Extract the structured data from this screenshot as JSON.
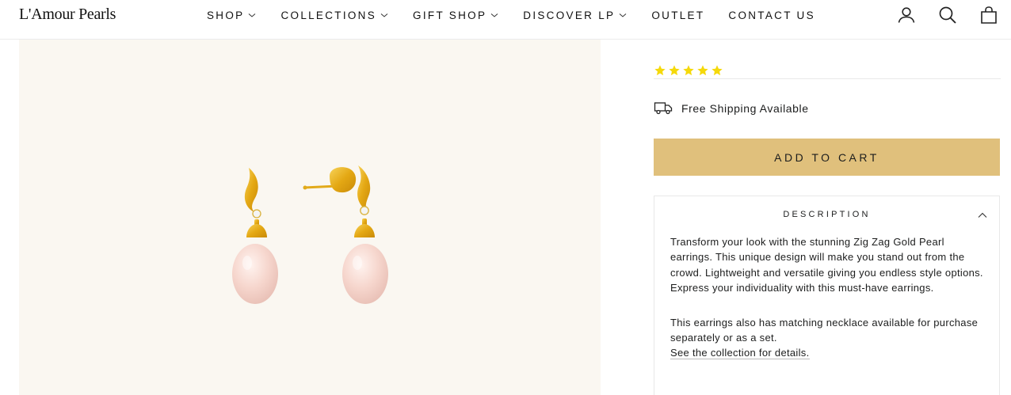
{
  "brand": {
    "logo_text": "L'Amour Pearls"
  },
  "nav": {
    "items": [
      {
        "label": "SHOP",
        "has_dropdown": true
      },
      {
        "label": "COLLECTIONS",
        "has_dropdown": true
      },
      {
        "label": "GIFT SHOP",
        "has_dropdown": true
      },
      {
        "label": "DISCOVER LP",
        "has_dropdown": true
      },
      {
        "label": "OUTLET",
        "has_dropdown": false
      },
      {
        "label": "CONTACT US",
        "has_dropdown": false
      }
    ]
  },
  "header_icons": [
    "user-icon",
    "search-icon",
    "cart-icon"
  ],
  "product": {
    "rating": {
      "stars": 5,
      "star_color": "#f5d90a"
    },
    "shipping_text": "Free Shipping Available",
    "add_to_cart_label": "ADD TO CART",
    "button_color": "#e0c07c",
    "description": {
      "title": "DESCRIPTION",
      "paragraph_1": "Transform your look with the stunning Zig Zag Gold Pearl earrings. This unique design will make you stand out from the crowd. Lightweight and versatile giving you endless style options. Express your individuality with this must-have earrings.",
      "paragraph_2": "This earrings also has matching necklace available for purchase separately or as a set.",
      "link_text": "See the collection for details."
    }
  },
  "colors": {
    "gallery_bg": "#faf7f1",
    "gold": "#e9b820",
    "pearl": "#f7dcd3"
  }
}
